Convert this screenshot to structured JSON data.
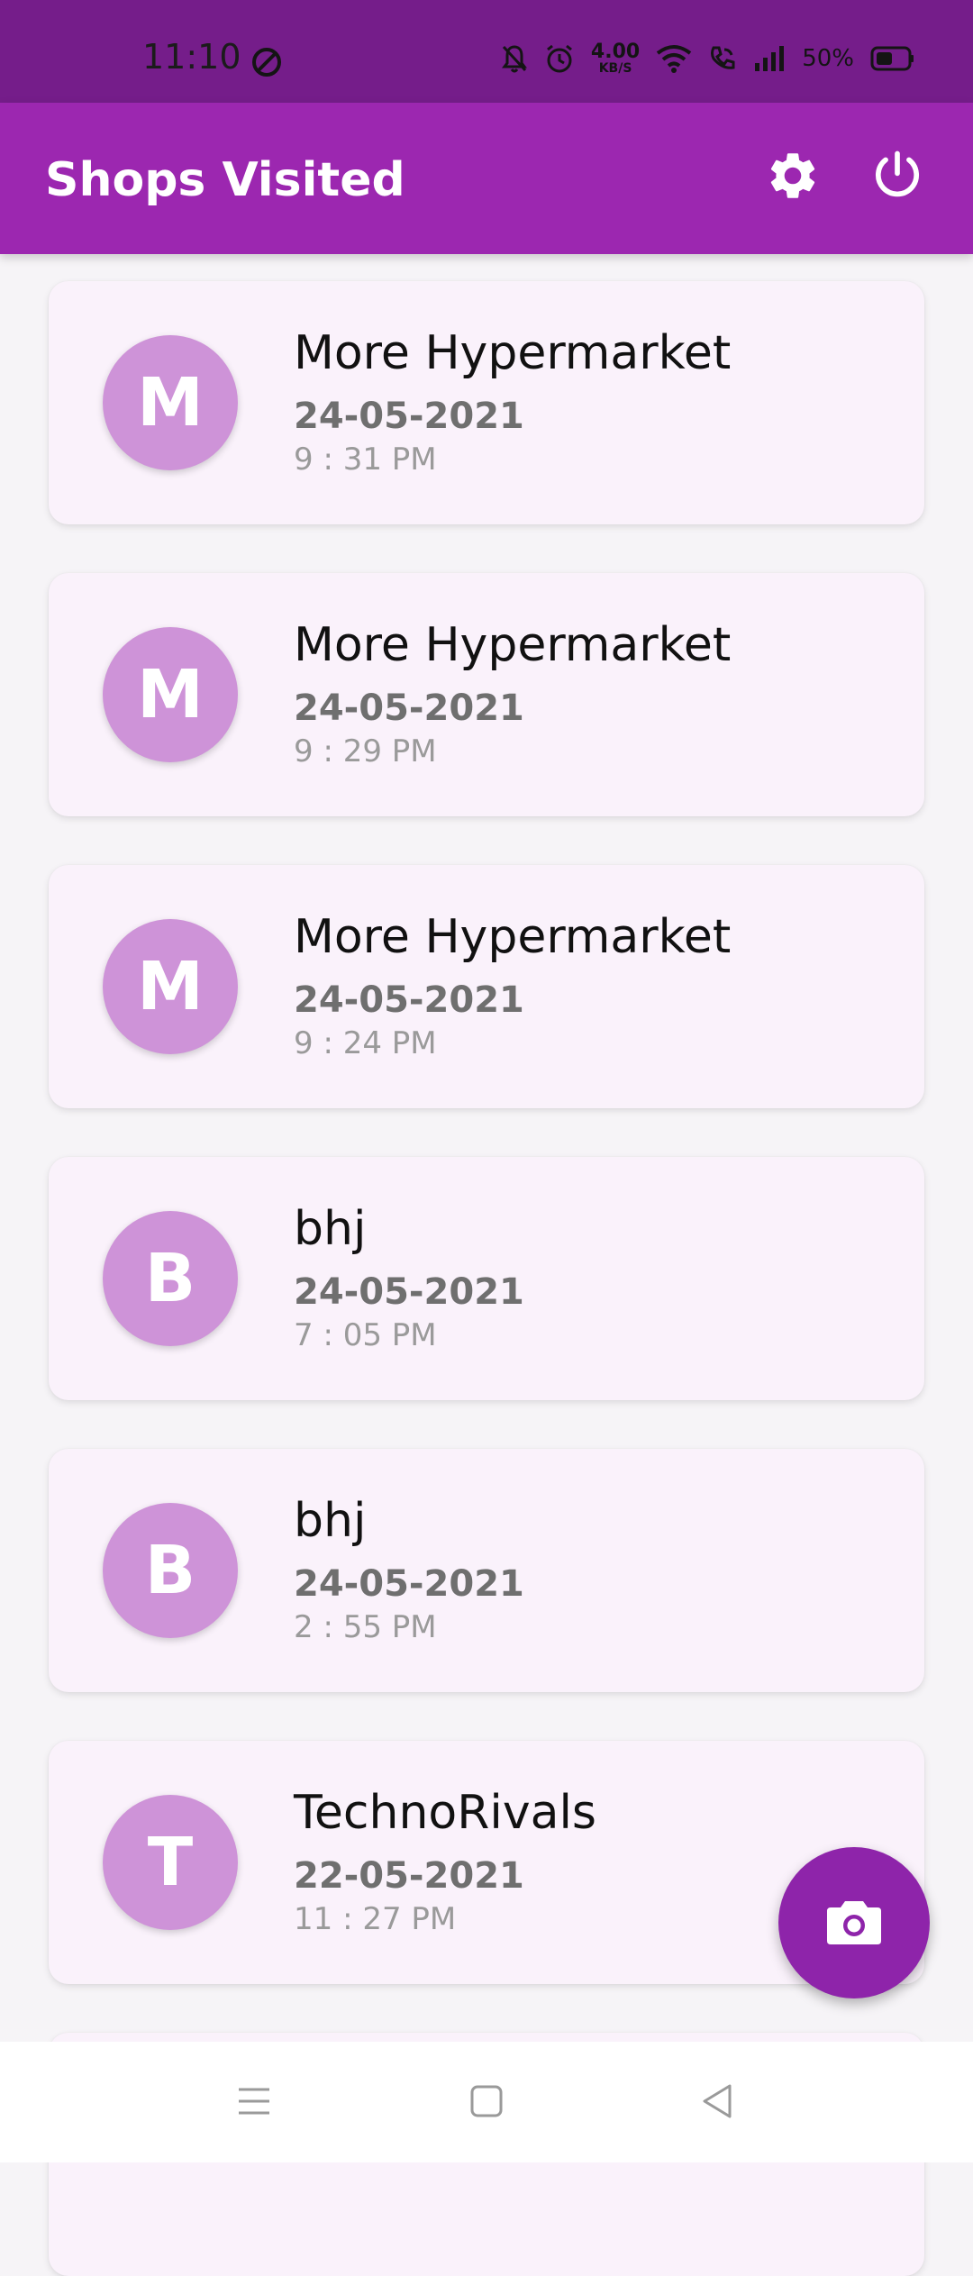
{
  "status_bar": {
    "time": "11:10",
    "network_speed_value": "4.00",
    "network_speed_unit": "KB/S",
    "battery_percent": "50%"
  },
  "app_bar": {
    "title": "Shops Visited",
    "actions": [
      "settings-icon",
      "power-icon"
    ]
  },
  "colors": {
    "app_bar": "#9c27b0",
    "status_bar": "#751d8a",
    "avatar": "#ce93d8",
    "card": "#faf2fb",
    "fab": "#8e24aa"
  },
  "visits": [
    {
      "initial": "M",
      "name": "More Hypermarket",
      "date": "24-05-2021",
      "time": "9 : 31 PM"
    },
    {
      "initial": "M",
      "name": "More Hypermarket",
      "date": "24-05-2021",
      "time": "9 : 29 PM"
    },
    {
      "initial": "M",
      "name": "More Hypermarket",
      "date": "24-05-2021",
      "time": "9 : 24 PM"
    },
    {
      "initial": "B",
      "name": "bhj",
      "date": "24-05-2021",
      "time": "7 : 05 PM"
    },
    {
      "initial": "B",
      "name": "bhj",
      "date": "24-05-2021",
      "time": "2 : 55 PM"
    },
    {
      "initial": "T",
      "name": "TechnoRivals",
      "date": "22-05-2021",
      "time": "11 : 27 PM"
    }
  ],
  "fab": {
    "icon": "camera-icon"
  },
  "nav_bar": {
    "buttons": [
      "menu-icon",
      "home-icon",
      "back-icon"
    ]
  }
}
